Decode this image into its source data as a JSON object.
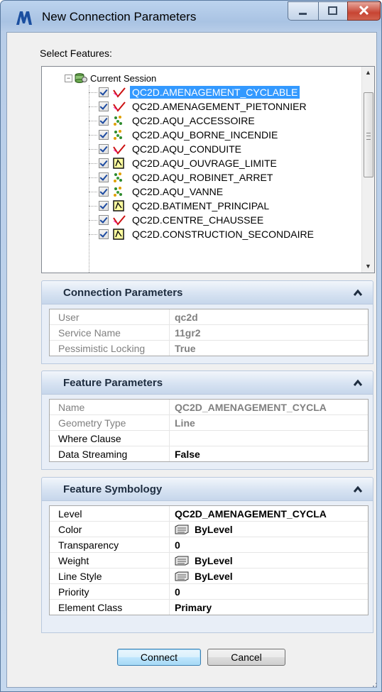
{
  "window": {
    "title": "New Connection Parameters"
  },
  "select_features": {
    "label": "Select Features:",
    "root": "Current Session",
    "items": [
      {
        "label": "QC2D.AMENAGEMENT_CYCLABLE",
        "icon": "line-feature-icon",
        "selected": true
      },
      {
        "label": "QC2D.AMENAGEMENT_PIETONNIER",
        "icon": "line-feature-icon"
      },
      {
        "label": "QC2D.AQU_ACCESSOIRE",
        "icon": "point-feature-icon"
      },
      {
        "label": "QC2D.AQU_BORNE_INCENDIE",
        "icon": "point-feature-icon"
      },
      {
        "label": "QC2D.AQU_CONDUITE",
        "icon": "line-feature-icon"
      },
      {
        "label": "QC2D.AQU_OUVRAGE_LIMITE",
        "icon": "area-feature-icon"
      },
      {
        "label": "QC2D.AQU_ROBINET_ARRET",
        "icon": "point-feature-icon"
      },
      {
        "label": "QC2D.AQU_VANNE",
        "icon": "point-feature-icon"
      },
      {
        "label": "QC2D.BATIMENT_PRINCIPAL",
        "icon": "area-feature-icon"
      },
      {
        "label": "QC2D.CENTRE_CHAUSSEE",
        "icon": "line-feature-icon"
      },
      {
        "label": "QC2D.CONSTRUCTION_SECONDAIRE",
        "icon": "area-feature-icon"
      }
    ]
  },
  "connection_parameters": {
    "title": "Connection Parameters",
    "rows": [
      {
        "name": "User",
        "value": "qc2d"
      },
      {
        "name": "Service Name",
        "value": "11gr2"
      },
      {
        "name": "Pessimistic Locking",
        "value": "True"
      }
    ]
  },
  "feature_parameters": {
    "title": "Feature Parameters",
    "rows": [
      {
        "name": "Name",
        "value": "QC2D_AMENAGEMENT_CYCLA"
      },
      {
        "name": "Geometry Type",
        "value": "Line"
      },
      {
        "name": "Where Clause",
        "value": ""
      },
      {
        "name": "Data Streaming",
        "value": "False"
      }
    ]
  },
  "feature_symbology": {
    "title": "Feature Symbology",
    "rows": [
      {
        "name": "Level",
        "value": "QC2D_AMENAGEMENT_CYCLA"
      },
      {
        "name": "Color",
        "value": "ByLevel",
        "icon": "bylevel-icon"
      },
      {
        "name": "Transparency",
        "value": "0"
      },
      {
        "name": "Weight",
        "value": "ByLevel",
        "icon": "bylevel-icon"
      },
      {
        "name": "Line Style",
        "value": "ByLevel",
        "icon": "bylevel-icon"
      },
      {
        "name": "Priority",
        "value": "0"
      },
      {
        "name": "Element Class",
        "value": "Primary"
      }
    ]
  },
  "buttons": {
    "connect": "Connect",
    "cancel": "Cancel"
  },
  "colors": {
    "selection": "#3399ff",
    "panel_header": "#d7e3f2",
    "line_icon": "#cc1111"
  }
}
